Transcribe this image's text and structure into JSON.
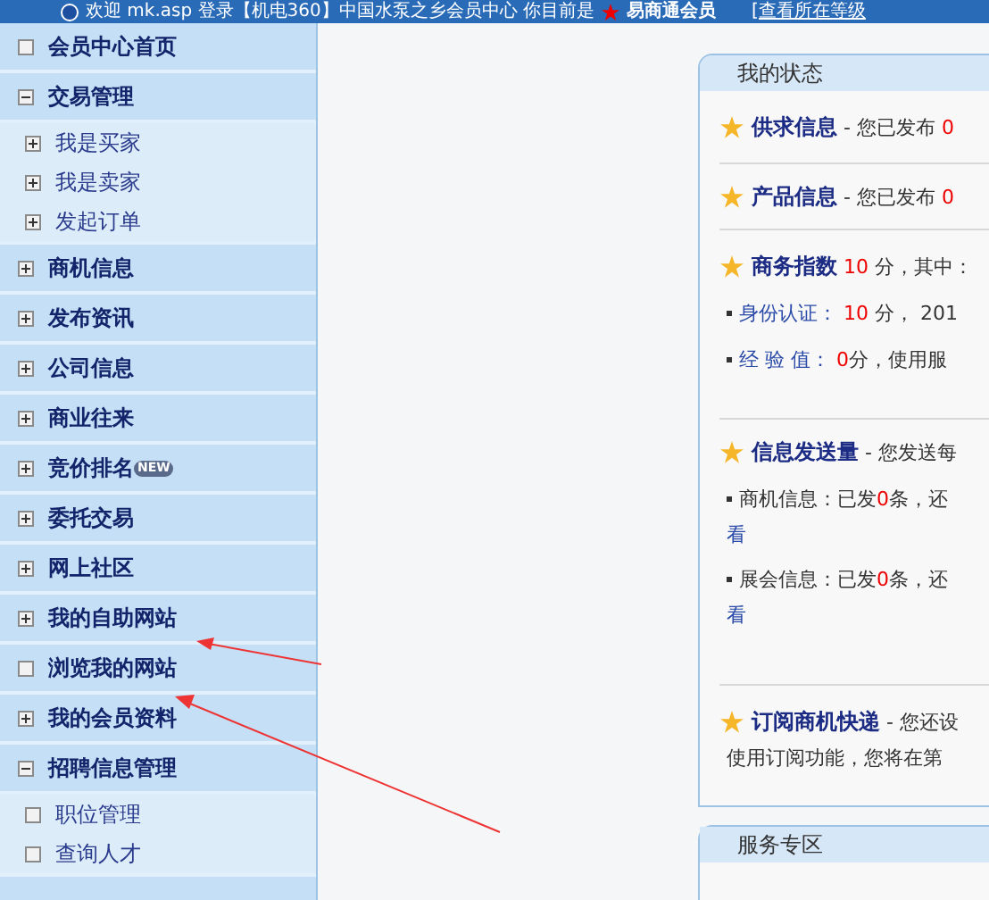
{
  "top_bar": {
    "text": "欢迎 mk.asp 登录【机电360】中国水泵之乡会员中心   你目前是",
    "level_name": "易商通会员",
    "link": "[查看所在等级"
  },
  "sidebar": {
    "items": [
      {
        "label": "会员中心首页",
        "kind": "link"
      },
      {
        "label": "交易管理",
        "kind": "expandable",
        "expanded": true,
        "children": [
          {
            "label": "我是买家",
            "kind": "expandable",
            "expanded": false
          },
          {
            "label": "我是卖家",
            "kind": "expandable",
            "expanded": false
          },
          {
            "label": "发起订单",
            "kind": "expandable",
            "expanded": false
          }
        ]
      },
      {
        "label": "商机信息",
        "kind": "expandable",
        "expanded": false
      },
      {
        "label": "发布资讯",
        "kind": "expandable",
        "expanded": false
      },
      {
        "label": "公司信息",
        "kind": "expandable",
        "expanded": false
      },
      {
        "label": "商业往来",
        "kind": "expandable",
        "expanded": false
      },
      {
        "label": "竞价排名",
        "kind": "expandable",
        "expanded": false,
        "badge": "NEW"
      },
      {
        "label": "委托交易",
        "kind": "expandable",
        "expanded": false
      },
      {
        "label": "网上社区",
        "kind": "expandable",
        "expanded": false
      },
      {
        "label": "我的自助网站",
        "kind": "expandable",
        "expanded": false
      },
      {
        "label": "浏览我的网站",
        "kind": "link"
      },
      {
        "label": "我的会员资料",
        "kind": "expandable",
        "expanded": false
      },
      {
        "label": "招聘信息管理",
        "kind": "expandable",
        "expanded": true,
        "children": [
          {
            "label": "职位管理",
            "kind": "link"
          },
          {
            "label": "查询人才",
            "kind": "link"
          }
        ]
      }
    ]
  },
  "status_panel": {
    "title": "我的状态",
    "sections": [
      {
        "lines": [
          {
            "kind": "head",
            "parts": [
              {
                "kind": "label",
                "text": "供求信息"
              },
              {
                "kind": "plain",
                "text": " - 您已发布 "
              },
              {
                "kind": "num",
                "text": "0"
              }
            ]
          }
        ]
      },
      {
        "lines": [
          {
            "kind": "head",
            "parts": [
              {
                "kind": "label",
                "text": "产品信息"
              },
              {
                "kind": "plain",
                "text": " - 您已发布 "
              },
              {
                "kind": "num",
                "text": "0"
              }
            ]
          }
        ]
      },
      {
        "lines": [
          {
            "kind": "head",
            "parts": [
              {
                "kind": "label",
                "text": "商务指数"
              },
              {
                "kind": "num",
                "text": " 10 "
              },
              {
                "kind": "plain",
                "text": "分，其中："
              }
            ]
          },
          {
            "kind": "bullet",
            "parts": [
              {
                "kind": "sublabel",
                "text": "身份认证："
              },
              {
                "kind": "num",
                "text": " 10 "
              },
              {
                "kind": "plain",
                "text": "分， 201"
              }
            ]
          },
          {
            "kind": "bullet",
            "parts": [
              {
                "kind": "sublabel",
                "text": "经 验 值："
              },
              {
                "kind": "num",
                "text": " 0"
              },
              {
                "kind": "plain",
                "text": "分，使用服"
              }
            ]
          }
        ]
      },
      {
        "lines": [
          {
            "kind": "head",
            "parts": [
              {
                "kind": "label",
                "text": "信息发送量"
              },
              {
                "kind": "plain",
                "text": " - 您发送每"
              }
            ]
          },
          {
            "kind": "bullet",
            "parts": [
              {
                "kind": "plain",
                "text": "商机信息：已发"
              },
              {
                "kind": "num",
                "text": "0"
              },
              {
                "kind": "plain",
                "text": "条，还"
              }
            ]
          },
          {
            "kind": "wrap",
            "parts": [
              {
                "kind": "link",
                "text": "看"
              }
            ]
          },
          {
            "kind": "bullet",
            "parts": [
              {
                "kind": "plain",
                "text": "展会信息：已发"
              },
              {
                "kind": "num",
                "text": "0"
              },
              {
                "kind": "plain",
                "text": "条，还"
              }
            ]
          },
          {
            "kind": "wrap",
            "parts": [
              {
                "kind": "link",
                "text": "看"
              }
            ]
          }
        ]
      },
      {
        "lines": [
          {
            "kind": "head",
            "parts": [
              {
                "kind": "label",
                "text": "订阅商机快递"
              },
              {
                "kind": "plain",
                "text": " - 您还设"
              }
            ]
          },
          {
            "kind": "wrap",
            "parts": [
              {
                "kind": "plain",
                "text": "使用订阅功能，您将在第"
              }
            ]
          }
        ]
      }
    ]
  },
  "service_panel": {
    "title": "服务专区"
  }
}
